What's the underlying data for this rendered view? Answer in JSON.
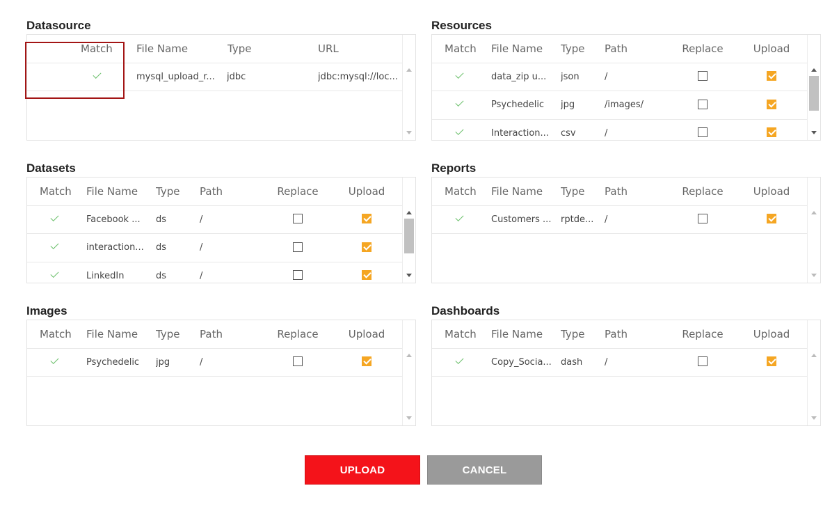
{
  "datasource": {
    "title": "Datasource",
    "columns": [
      "Match",
      "File Name",
      "Type",
      "URL"
    ],
    "rows": [
      {
        "match": true,
        "file_name": "mysql_upload_r...",
        "type": "jdbc",
        "url": "jdbc:mysql://loc..."
      }
    ]
  },
  "resources": {
    "title": "Resources",
    "columns": [
      "Match",
      "File Name",
      "Type",
      "Path",
      "Replace",
      "Upload"
    ],
    "rows": [
      {
        "match": true,
        "file_name": "data_zip u...",
        "type": "json",
        "path": "/",
        "replace": false,
        "upload": true
      },
      {
        "match": true,
        "file_name": "Psychedelic",
        "type": "jpg",
        "path": "/images/",
        "replace": false,
        "upload": true
      },
      {
        "match": true,
        "file_name": "Interaction...",
        "type": "csv",
        "path": "/",
        "replace": false,
        "upload": true
      }
    ]
  },
  "datasets": {
    "title": "Datasets",
    "columns": [
      "Match",
      "File Name",
      "Type",
      "Path",
      "Replace",
      "Upload"
    ],
    "rows": [
      {
        "match": true,
        "file_name": "Facebook ...",
        "type": "ds",
        "path": "/",
        "replace": false,
        "upload": true
      },
      {
        "match": true,
        "file_name": "interaction...",
        "type": "ds",
        "path": "/",
        "replace": false,
        "upload": true
      },
      {
        "match": true,
        "file_name": "LinkedIn",
        "type": "ds",
        "path": "/",
        "replace": false,
        "upload": true
      }
    ]
  },
  "reports": {
    "title": "Reports",
    "columns": [
      "Match",
      "File Name",
      "Type",
      "Path",
      "Replace",
      "Upload"
    ],
    "rows": [
      {
        "match": true,
        "file_name": "Customers ...",
        "type": "rptde...",
        "path": "/",
        "replace": false,
        "upload": true
      }
    ]
  },
  "images": {
    "title": "Images",
    "columns": [
      "Match",
      "File Name",
      "Type",
      "Path",
      "Replace",
      "Upload"
    ],
    "rows": [
      {
        "match": true,
        "file_name": "Psychedelic",
        "type": "jpg",
        "path": "/",
        "replace": false,
        "upload": true
      }
    ]
  },
  "dashboards": {
    "title": "Dashboards",
    "columns": [
      "Match",
      "File Name",
      "Type",
      "Path",
      "Replace",
      "Upload"
    ],
    "rows": [
      {
        "match": true,
        "file_name": "Copy_Socia...",
        "type": "dash",
        "path": "/",
        "replace": false,
        "upload": true
      }
    ]
  },
  "buttons": {
    "upload_label": "UPLOAD",
    "cancel_label": "CANCEL"
  },
  "colors": {
    "match_tick": "#6cc06c",
    "upload_checked": "#f5a623",
    "upload_button": "#f4131a",
    "cancel_button": "#9a9a9a",
    "highlight_border": "#a31515"
  }
}
